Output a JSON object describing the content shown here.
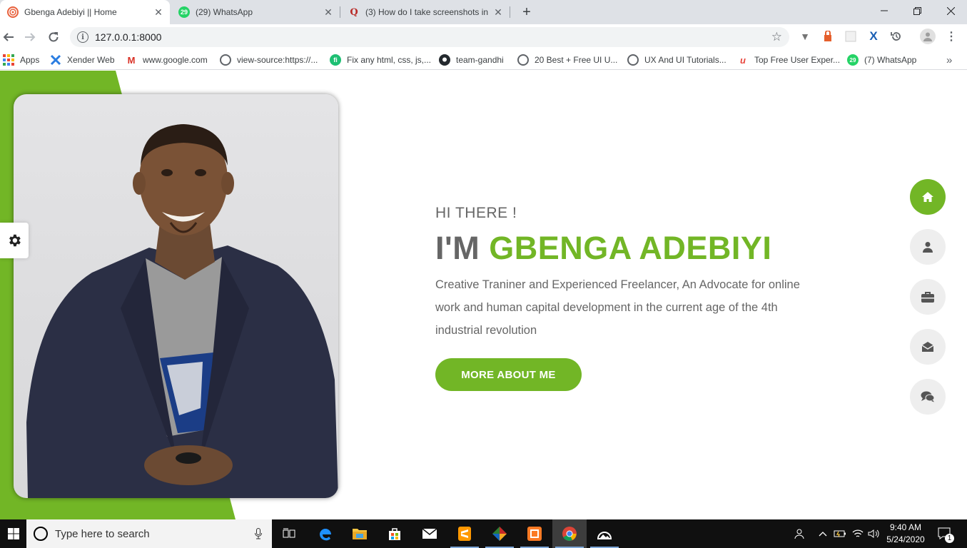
{
  "browser": {
    "tabs": [
      {
        "title": "Gbenga Adebiyi || Home",
        "active": true
      },
      {
        "title": "(29) WhatsApp",
        "favicon_text": "29"
      },
      {
        "title": "(3) How do I take screenshots in",
        "favicon_text": "Q"
      }
    ],
    "new_tab": "+",
    "url": "127.0.0.1:8000",
    "bookmarks": [
      {
        "label": "Apps"
      },
      {
        "label": "Xender Web"
      },
      {
        "label": "www.google.com"
      },
      {
        "label": "view-source:https://..."
      },
      {
        "label": "Fix any html, css, js,..."
      },
      {
        "label": "team-gandhi"
      },
      {
        "label": "20 Best + Free UI U..."
      },
      {
        "label": "UX And UI Tutorials..."
      },
      {
        "label": "Top Free User Exper..."
      },
      {
        "label": "(7) WhatsApp",
        "favicon_text": "29"
      }
    ],
    "more_bookmarks": "»"
  },
  "page": {
    "accent_color": "#72b626",
    "greeting": "HI THERE !",
    "name_prefix": "I'M",
    "name_highlight": "GBENGA ADEBIYI",
    "description": "Creative Traniner and Experienced Freelancer, An Advocate for online work and human capital development in the current age of the 4th industrial revolution",
    "cta_label": "MORE ABOUT ME",
    "side_nav": [
      {
        "icon": "home-icon",
        "active": true
      },
      {
        "icon": "user-icon"
      },
      {
        "icon": "briefcase-icon"
      },
      {
        "icon": "envelope-icon"
      },
      {
        "icon": "comments-icon"
      }
    ]
  },
  "taskbar": {
    "search_placeholder": "Type here to search",
    "time": "9:40 AM",
    "date": "5/24/2020",
    "notification_count": "1"
  }
}
